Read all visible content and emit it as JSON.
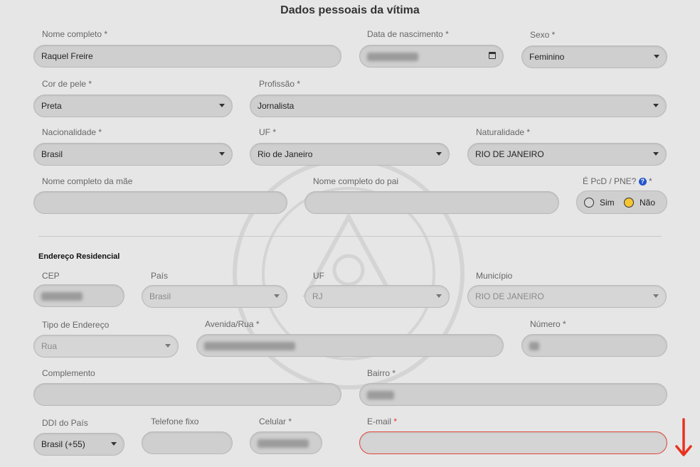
{
  "header": {
    "title": "Dados pessoais da vítima"
  },
  "personal": {
    "nome_completo": {
      "label": "Nome completo *",
      "value": "Raquel Freire"
    },
    "data_nascimento": {
      "label": "Data de nascimento *"
    },
    "sexo": {
      "label": "Sexo *",
      "value": "Feminino"
    },
    "cor_pele": {
      "label": "Cor de pele *",
      "value": "Preta"
    },
    "profissao": {
      "label": "Profissão *",
      "value": "Jornalista"
    },
    "nacionalidade": {
      "label": "Nacionalidade *",
      "value": "Brasil"
    },
    "uf": {
      "label": "UF *",
      "value": "Rio de Janeiro"
    },
    "naturalidade": {
      "label": "Naturalidade *",
      "value": "RIO DE JANEIRO"
    },
    "nome_mae": {
      "label": "Nome completo da mãe",
      "value": ""
    },
    "nome_pai": {
      "label": "Nome completo do pai",
      "value": ""
    },
    "pcd": {
      "label": "É PcD / PNE?",
      "help": "?",
      "star": "*",
      "option_yes": "Sim",
      "option_no": "Não",
      "selected": "Não"
    }
  },
  "address": {
    "section_title": "Endereço Residencial",
    "cep": {
      "label": "CEP"
    },
    "pais": {
      "label": "País",
      "value": "Brasil"
    },
    "uf": {
      "label": "UF",
      "value": "RJ"
    },
    "municipio": {
      "label": "Município",
      "value": "RIO DE JANEIRO"
    },
    "tipo_endereco": {
      "label": "Tipo de Endereço",
      "value": "Rua"
    },
    "avenida_rua": {
      "label": "Avenida/Rua *"
    },
    "numero": {
      "label": "Número *"
    },
    "complemento": {
      "label": "Complemento",
      "value": ""
    },
    "bairro": {
      "label": "Bairro *"
    }
  },
  "contact": {
    "ddi": {
      "label": "DDI do País",
      "value": "Brasil (+55)"
    },
    "telefone_fixo": {
      "label": "Telefone fixo",
      "value": ""
    },
    "celular": {
      "label": "Celular *"
    },
    "email": {
      "label": "E-mail",
      "star": "*",
      "value": ""
    }
  },
  "colors": {
    "accent_error": "#e0463a",
    "radio_selected": "#f4c531",
    "help_icon": "#2255cc"
  },
  "icons": {
    "dropdown": "chevron-down-icon",
    "calendar": "calendar-icon",
    "annotation": "arrow-down-icon"
  }
}
